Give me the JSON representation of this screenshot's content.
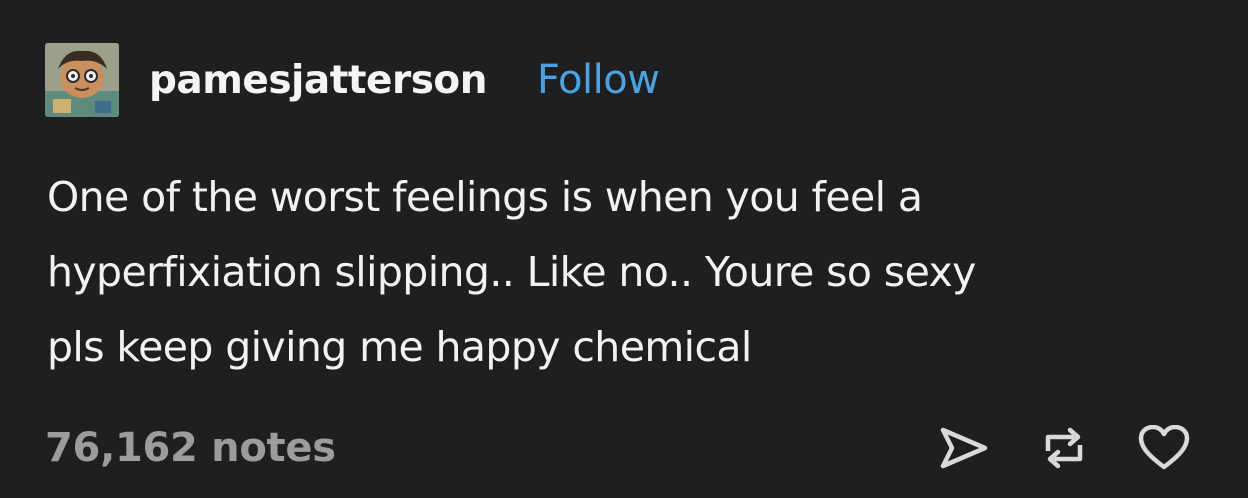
{
  "post": {
    "username": "pamesjatterson",
    "follow_label": "Follow",
    "body_lines": [
      "One of the worst feelings is when you feel a",
      "hyperfixiation slipping.. Like no.. Youre so sexy",
      "pls keep giving me happy chemical"
    ],
    "notes": "76,162 notes"
  },
  "icons": {
    "avatar": "avatar-image",
    "share": "share-icon",
    "reblog": "reblog-icon",
    "like": "heart-icon"
  },
  "colors": {
    "background": "#1f1f21",
    "text": "#f2f2f2",
    "follow": "#4aa3e0",
    "notes": "#9c9c9c",
    "icon": "#d9d9d9"
  }
}
